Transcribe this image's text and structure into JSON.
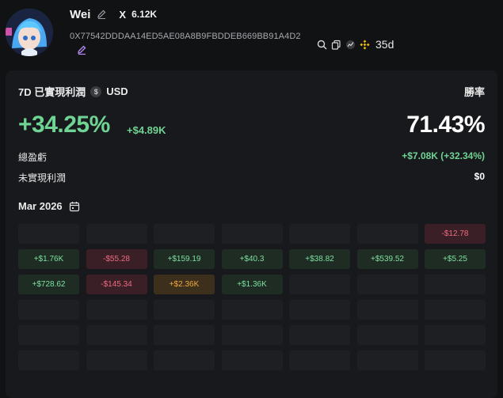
{
  "profile": {
    "name": "Wei",
    "x_followers": "6.12K",
    "x_label": "X",
    "address": "0X77542DDDAA14ED5AE08A8B9FBDDEB669BB91A4D2",
    "days": "35d"
  },
  "stats": {
    "period_label": "7D 已實現利潤",
    "currency": "USD",
    "winrate_label": "勝率",
    "pnl_percent": "+34.25%",
    "pnl_amount": "+$4.89K",
    "winrate": "71.43%",
    "total_label": "總盈虧",
    "total_value": "+$7.08K (+32.34%)",
    "unrealized_label": "未實現利潤",
    "unrealized_value": "$0"
  },
  "calendar": {
    "month": "Mar 2026",
    "cells": [
      {
        "text": "",
        "kind": "empty"
      },
      {
        "text": "",
        "kind": "empty"
      },
      {
        "text": "",
        "kind": "empty"
      },
      {
        "text": "",
        "kind": "empty"
      },
      {
        "text": "",
        "kind": "empty"
      },
      {
        "text": "",
        "kind": "empty"
      },
      {
        "text": "-$12.78",
        "kind": "neg"
      },
      {
        "text": "+$1.76K",
        "kind": "pos"
      },
      {
        "text": "-$55.28",
        "kind": "neg"
      },
      {
        "text": "+$159.19",
        "kind": "pos"
      },
      {
        "text": "+$40.3",
        "kind": "pos"
      },
      {
        "text": "+$38.82",
        "kind": "pos"
      },
      {
        "text": "+$539.52",
        "kind": "pos"
      },
      {
        "text": "+$5.25",
        "kind": "pos"
      },
      {
        "text": "+$728.62",
        "kind": "pos"
      },
      {
        "text": "-$145.34",
        "kind": "neg"
      },
      {
        "text": "+$2.36K",
        "kind": "big"
      },
      {
        "text": "+$1.36K",
        "kind": "pos"
      },
      {
        "text": "",
        "kind": "empty"
      },
      {
        "text": "",
        "kind": "empty"
      },
      {
        "text": "",
        "kind": "empty"
      },
      {
        "text": "",
        "kind": "empty"
      },
      {
        "text": "",
        "kind": "empty"
      },
      {
        "text": "",
        "kind": "empty"
      },
      {
        "text": "",
        "kind": "empty"
      },
      {
        "text": "",
        "kind": "empty"
      },
      {
        "text": "",
        "kind": "empty"
      },
      {
        "text": "",
        "kind": "empty"
      },
      {
        "text": "",
        "kind": "empty"
      },
      {
        "text": "",
        "kind": "empty"
      },
      {
        "text": "",
        "kind": "empty"
      },
      {
        "text": "",
        "kind": "empty"
      },
      {
        "text": "",
        "kind": "empty"
      },
      {
        "text": "",
        "kind": "empty"
      },
      {
        "text": "",
        "kind": "empty"
      },
      {
        "text": "",
        "kind": "empty"
      },
      {
        "text": "",
        "kind": "empty"
      },
      {
        "text": "",
        "kind": "empty"
      },
      {
        "text": "",
        "kind": "empty"
      },
      {
        "text": "",
        "kind": "empty"
      },
      {
        "text": "",
        "kind": "empty"
      },
      {
        "text": "",
        "kind": "empty"
      }
    ]
  },
  "colors": {
    "positive": "#6fd394",
    "negative": "#ef6b82",
    "highlight": "#f2a93b",
    "background": "#111214",
    "card": "#18191c"
  }
}
